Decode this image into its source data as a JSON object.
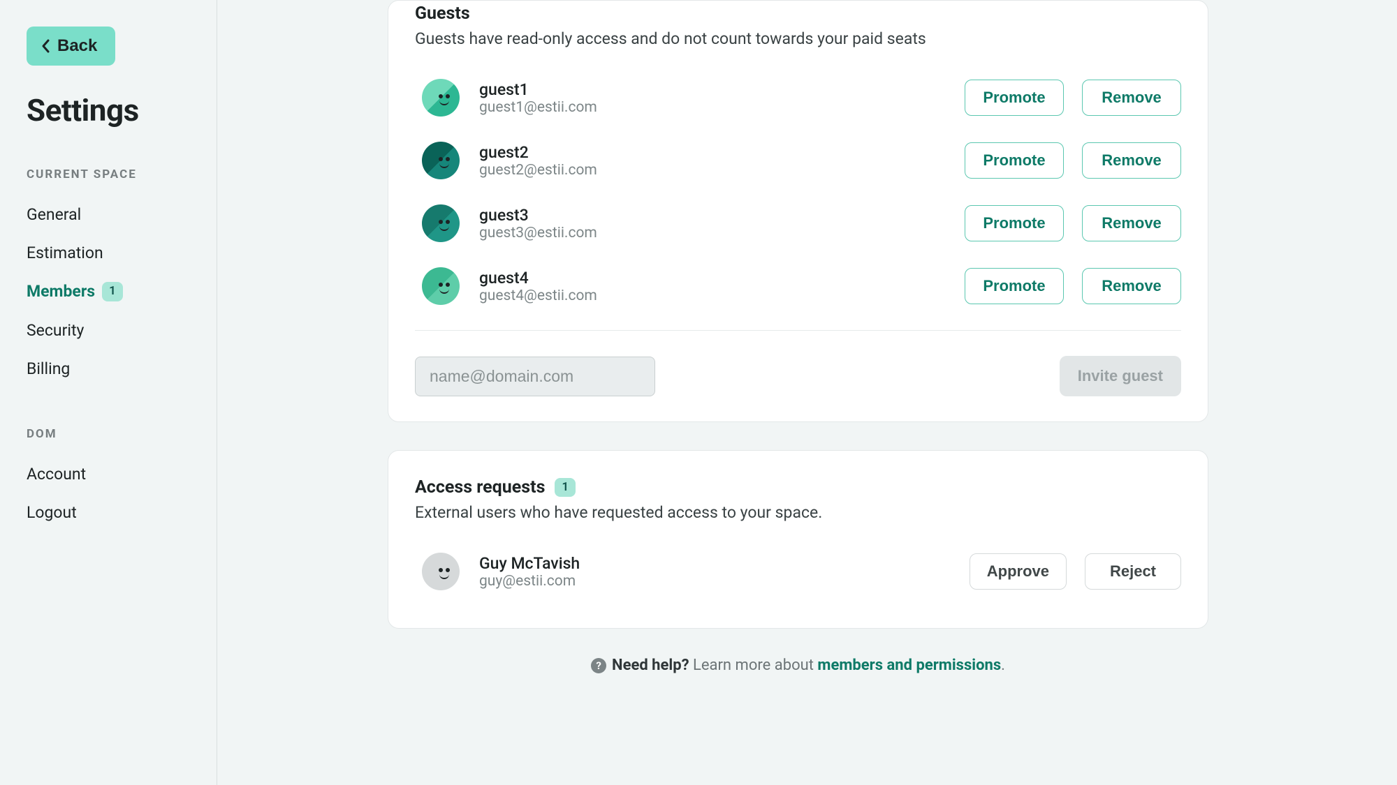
{
  "sidebar": {
    "back_label": "Back",
    "title": "Settings",
    "sections": [
      {
        "label": "CURRENT SPACE",
        "items": [
          {
            "label": "General",
            "active": false
          },
          {
            "label": "Estimation",
            "active": false
          },
          {
            "label": "Members",
            "active": true,
            "badge": "1"
          },
          {
            "label": "Security",
            "active": false
          },
          {
            "label": "Billing",
            "active": false
          }
        ]
      },
      {
        "label": "DOM",
        "items": [
          {
            "label": "Account",
            "active": false
          },
          {
            "label": "Logout",
            "active": false
          }
        ]
      }
    ]
  },
  "guests": {
    "title": "Guests",
    "description": "Guests have read-only access and do not count towards your paid seats",
    "promote_label": "Promote",
    "remove_label": "Remove",
    "invite_placeholder": "name@domain.com",
    "invite_button": "Invite guest",
    "list": [
      {
        "name": "guest1",
        "email": "guest1@estii.com"
      },
      {
        "name": "guest2",
        "email": "guest2@estii.com"
      },
      {
        "name": "guest3",
        "email": "guest3@estii.com"
      },
      {
        "name": "guest4",
        "email": "guest4@estii.com"
      }
    ]
  },
  "requests": {
    "title": "Access requests",
    "badge": "1",
    "description": "External users who have requested access to your space.",
    "approve_label": "Approve",
    "reject_label": "Reject",
    "list": [
      {
        "name": "Guy McTavish",
        "email": "guy@estii.com"
      }
    ]
  },
  "help": {
    "strong": "Need help?",
    "text": "Learn more about",
    "link": "members and permissions",
    "period": "."
  }
}
